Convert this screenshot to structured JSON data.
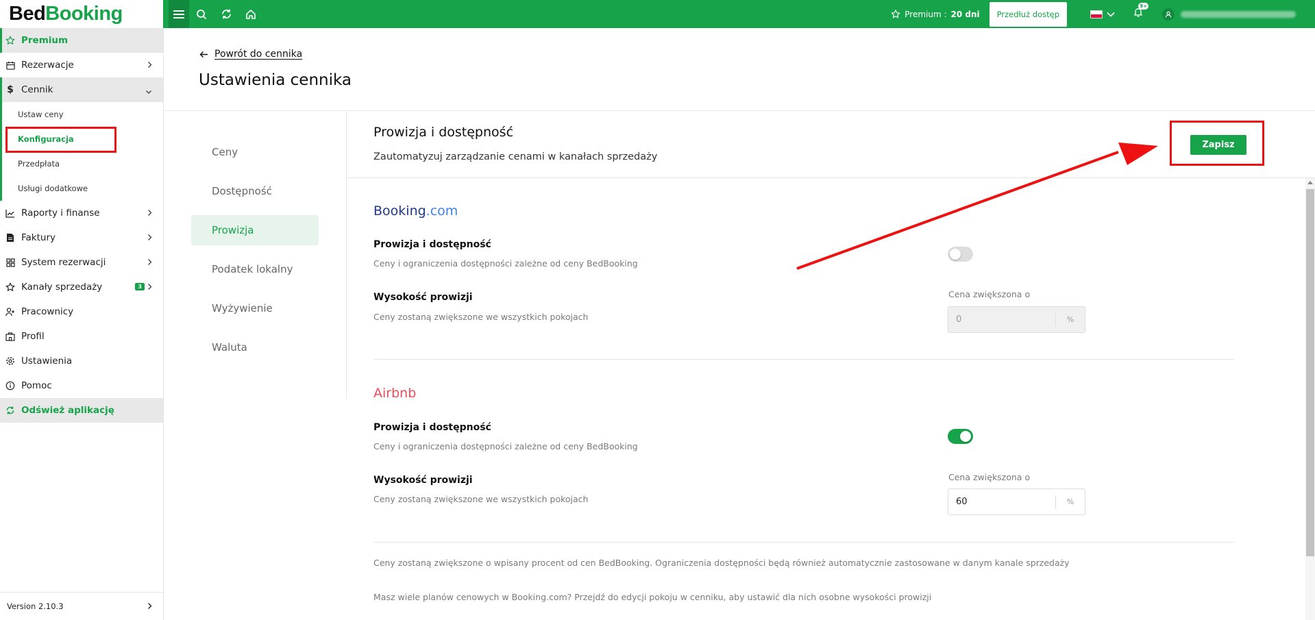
{
  "app": {
    "logo_part1": "Bed",
    "logo_part2": "Booking"
  },
  "topbar": {
    "premium_label": "Premium :",
    "premium_days": "20 dni",
    "extend_button": "Przedłuż dostęp",
    "notification_badge": "9+"
  },
  "sidebar": {
    "premium": "Premium",
    "items": {
      "rezerwacje": "Rezerwacje",
      "cennik": "Cennik",
      "raporty": "Raporty i finanse",
      "faktury": "Faktury",
      "system": "System rezerwacji",
      "kanaly": "Kanały sprzedaży",
      "kanaly_badge": "3",
      "pracownicy": "Pracownicy",
      "profil": "Profil",
      "ustawienia": "Ustawienia",
      "pomoc": "Pomoc",
      "odswiez": "Odśwież aplikację"
    },
    "sub": {
      "ustaw_ceny": "Ustaw ceny",
      "konfiguracja": "Konfiguracja",
      "przedplata": "Przedpłata",
      "uslugi": "Usługi dodatkowe"
    },
    "version": "Version 2.10.3"
  },
  "header": {
    "back_link": "Powrót do cennika",
    "title": "Ustawienia cennika"
  },
  "tabs": [
    "Ceny",
    "Dostępność",
    "Prowizja",
    "Podatek lokalny",
    "Wyżywienie",
    "Waluta"
  ],
  "panel": {
    "title": "Prowizja i dostępność",
    "subtitle": "Zautomatyzuj zarządzanie cenami w kanałach sprzedaży",
    "save_button": "Zapisz"
  },
  "booking": {
    "name_main": "Booking",
    "name_dot": ".com",
    "toggle_title": "Prowizja i dostępność",
    "toggle_sub": "Ceny i ograniczenia dostępności zależne od ceny BedBooking",
    "toggle_on": false,
    "commission_title": "Wysokość prowizji",
    "commission_sub": "Ceny zostaną zwiększone we wszystkich pokojach",
    "field_label": "Cena zwiększona o",
    "field_value": "0",
    "unit": "%"
  },
  "airbnb": {
    "name": "Airbnb",
    "toggle_title": "Prowizja i dostępność",
    "toggle_sub": "Ceny i ograniczenia dostępności zależne od ceny BedBooking",
    "toggle_on": true,
    "commission_title": "Wysokość prowizji",
    "commission_sub": "Ceny zostaną zwiększone we wszystkich pokojach",
    "field_label": "Cena zwiększona o",
    "field_value": "60",
    "unit": "%"
  },
  "notes": {
    "note1": "Ceny zostaną zwiększone o wpisany procent od cen BedBooking. Ograniczenia dostępności będą również automatycznie zastosowane w danym kanale sprzedaży",
    "note2": "Masz wiele planów cenowych w Booking.com? Przejdź do edycji pokoju w cenniku, aby ustawić dla nich osobne wysokości prowizji"
  },
  "colors": {
    "brand_green": "#16a34a",
    "booking_blue": "#1e3a8a",
    "airbnb_red": "#ef4c5a",
    "annotation_red": "#ee1111"
  }
}
